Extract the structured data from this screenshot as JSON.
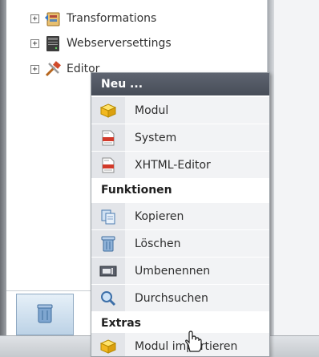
{
  "tree": {
    "items": [
      {
        "label": "Transformations",
        "expander": "+",
        "icon": "transformations-icon"
      },
      {
        "label": "Webserversettings",
        "expander": "+",
        "icon": "server-icon"
      },
      {
        "label": "Editor",
        "expander": "+",
        "icon": "editor-tools-icon"
      }
    ]
  },
  "context_menu": {
    "sections": [
      {
        "header": "Neu ...",
        "items": [
          {
            "label": "Modul",
            "icon": "module-box-icon"
          },
          {
            "label": "System",
            "icon": "document-icon"
          },
          {
            "label": "XHTML-Editor",
            "icon": "document-icon"
          }
        ]
      },
      {
        "header": "Funktionen",
        "items": [
          {
            "label": "Kopieren",
            "icon": "copy-icon"
          },
          {
            "label": "Löschen",
            "icon": "trash-icon"
          },
          {
            "label": "Umbenennen",
            "icon": "rename-icon"
          },
          {
            "label": "Durchsuchen",
            "icon": "magnifier-icon"
          }
        ]
      },
      {
        "header": "Extras",
        "items": [
          {
            "label": "Modul importieren",
            "icon": "module-box-icon"
          }
        ]
      }
    ]
  },
  "colors": {
    "menu_header_dark": "#4f5561",
    "menu_icon_column": "#e3e5e9",
    "menu_item_bg": "#f2f3f5"
  }
}
